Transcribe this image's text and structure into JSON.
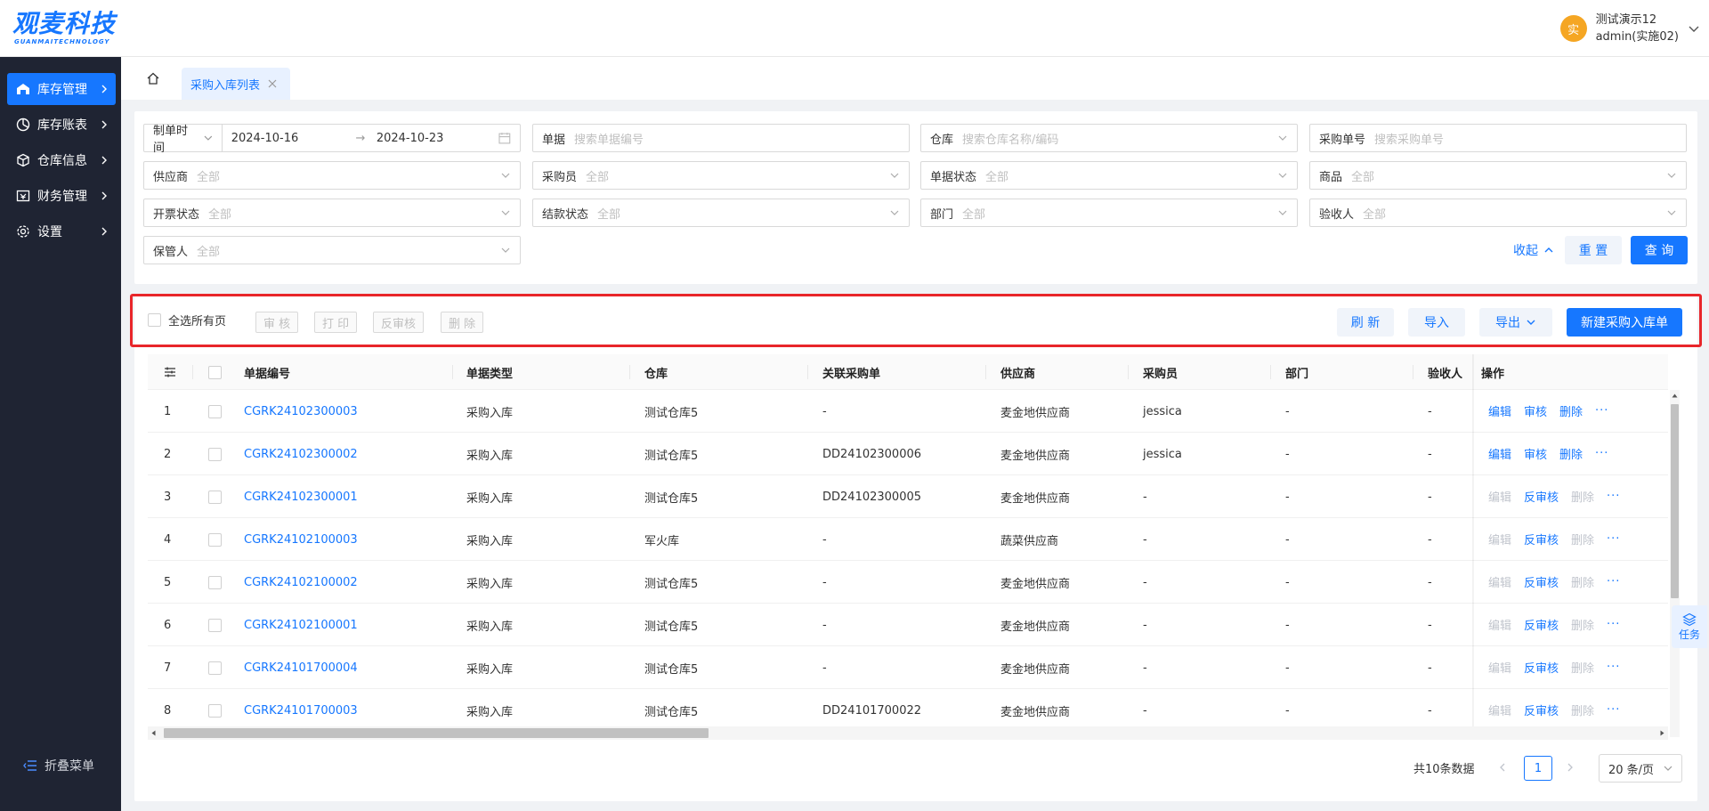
{
  "header": {
    "logo_text": "观麦科技",
    "logo_subtext": "GUANMAITECHNOLOGY",
    "avatar_text": "实",
    "user_name": "测试演示12",
    "user_account": "admin(实施02)"
  },
  "sidebar": {
    "items": [
      {
        "label": "库存管理",
        "icon": "warehouse-icon",
        "active": true
      },
      {
        "label": "库存账表",
        "icon": "pie-chart-icon",
        "active": false
      },
      {
        "label": "仓库信息",
        "icon": "box-icon",
        "active": false
      },
      {
        "label": "财务管理",
        "icon": "finance-icon",
        "active": false
      },
      {
        "label": "设置",
        "icon": "gear-icon",
        "active": false
      }
    ],
    "collapse_label": "折叠菜单"
  },
  "tabs": {
    "current": "采购入库列表"
  },
  "filters": {
    "date_type": "制单时间",
    "date_start": "2024-10-16",
    "date_sep": "→",
    "date_end": "2024-10-23",
    "doc_label": "单据",
    "doc_placeholder": "搜索单据编号",
    "warehouse_label": "仓库",
    "warehouse_placeholder": "搜索仓库名称/编码",
    "po_label": "采购单号",
    "po_placeholder": "搜索采购单号",
    "supplier_label": "供应商",
    "purchaser_label": "采购员",
    "doc_status_label": "单据状态",
    "product_label": "商品",
    "invoice_status_label": "开票状态",
    "payment_status_label": "结款状态",
    "dept_label": "部门",
    "acceptor_label": "验收人",
    "keeper_label": "保管人",
    "all_value": "全部",
    "collapse_label": "收起",
    "reset_label": "重 置",
    "query_label": "查 询"
  },
  "toolbar": {
    "select_all_label": "全选所有页",
    "audit_label": "审 核",
    "print_label": "打 印",
    "unaudit_label": "反审核",
    "delete_label": "删 除",
    "refresh_label": "刷 新",
    "import_label": "导入",
    "export_label": "导出",
    "new_label": "新建采购入库单"
  },
  "table": {
    "columns": [
      "单据编号",
      "单据类型",
      "仓库",
      "关联采购单",
      "供应商",
      "采购员",
      "部门",
      "验收人",
      "操作"
    ],
    "rows": [
      {
        "idx": "1",
        "no": "CGRK24102300003",
        "type": "采购入库",
        "warehouse": "测试仓库5",
        "po": "-",
        "supplier": "麦金地供应商",
        "purchaser": "jessica",
        "dept": "-",
        "acceptor": "-",
        "ops": [
          "编辑",
          "审核",
          "删除"
        ],
        "ops_enabled": [
          true,
          true,
          true
        ]
      },
      {
        "idx": "2",
        "no": "CGRK24102300002",
        "type": "采购入库",
        "warehouse": "测试仓库5",
        "po": "DD24102300006",
        "supplier": "麦金地供应商",
        "purchaser": "jessica",
        "dept": "-",
        "acceptor": "-",
        "ops": [
          "编辑",
          "审核",
          "删除"
        ],
        "ops_enabled": [
          true,
          true,
          true
        ]
      },
      {
        "idx": "3",
        "no": "CGRK24102300001",
        "type": "采购入库",
        "warehouse": "测试仓库5",
        "po": "DD24102300005",
        "supplier": "麦金地供应商",
        "purchaser": "-",
        "dept": "-",
        "acceptor": "-",
        "ops": [
          "编辑",
          "反审核",
          "删除"
        ],
        "ops_enabled": [
          false,
          true,
          false
        ]
      },
      {
        "idx": "4",
        "no": "CGRK24102100003",
        "type": "采购入库",
        "warehouse": "军火库",
        "po": "-",
        "supplier": "蔬菜供应商",
        "purchaser": "-",
        "dept": "-",
        "acceptor": "-",
        "ops": [
          "编辑",
          "反审核",
          "删除"
        ],
        "ops_enabled": [
          false,
          true,
          false
        ]
      },
      {
        "idx": "5",
        "no": "CGRK24102100002",
        "type": "采购入库",
        "warehouse": "测试仓库5",
        "po": "-",
        "supplier": "麦金地供应商",
        "purchaser": "-",
        "dept": "-",
        "acceptor": "-",
        "ops": [
          "编辑",
          "反审核",
          "删除"
        ],
        "ops_enabled": [
          false,
          true,
          false
        ]
      },
      {
        "idx": "6",
        "no": "CGRK24102100001",
        "type": "采购入库",
        "warehouse": "测试仓库5",
        "po": "-",
        "supplier": "麦金地供应商",
        "purchaser": "-",
        "dept": "-",
        "acceptor": "-",
        "ops": [
          "编辑",
          "反审核",
          "删除"
        ],
        "ops_enabled": [
          false,
          true,
          false
        ]
      },
      {
        "idx": "7",
        "no": "CGRK24101700004",
        "type": "采购入库",
        "warehouse": "测试仓库5",
        "po": "-",
        "supplier": "麦金地供应商",
        "purchaser": "-",
        "dept": "-",
        "acceptor": "-",
        "ops": [
          "编辑",
          "反审核",
          "删除"
        ],
        "ops_enabled": [
          false,
          true,
          false
        ]
      },
      {
        "idx": "8",
        "no": "CGRK24101700003",
        "type": "采购入库",
        "warehouse": "测试仓库5",
        "po": "DD24101700022",
        "supplier": "麦金地供应商",
        "purchaser": "-",
        "dept": "-",
        "acceptor": "-",
        "ops": [
          "编辑",
          "反审核",
          "删除"
        ],
        "ops_enabled": [
          false,
          true,
          false
        ]
      }
    ],
    "more_label": "···"
  },
  "task_label": "任务",
  "pagination": {
    "total_text": "共10条数据",
    "current_page": "1",
    "page_size": "20 条/页"
  },
  "colors": {
    "primary": "#1677ff",
    "sidebar_bg": "#1f2433",
    "highlight": "#e8262a",
    "avatar": "#f5a623"
  }
}
